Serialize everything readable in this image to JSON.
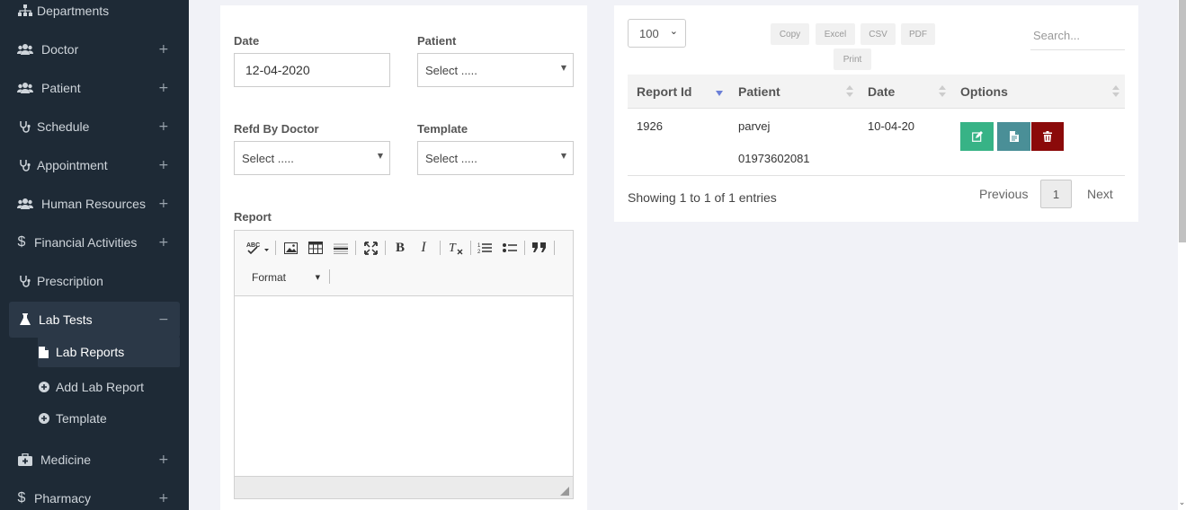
{
  "sidebar": {
    "items": [
      {
        "label": "Departments",
        "icon": "sitemap-icon",
        "expand": ""
      },
      {
        "label": "Doctor",
        "icon": "users-icon",
        "expand": "+"
      },
      {
        "label": "Patient",
        "icon": "users-icon",
        "expand": "+"
      },
      {
        "label": "Schedule",
        "icon": "stethoscope-icon",
        "expand": "+"
      },
      {
        "label": "Appointment",
        "icon": "stethoscope-icon",
        "expand": "+"
      },
      {
        "label": "Human Resources",
        "icon": "users-icon",
        "expand": "+"
      },
      {
        "label": "Financial Activities",
        "icon": "dollar-icon",
        "expand": "+"
      },
      {
        "label": "Prescription",
        "icon": "stethoscope-icon",
        "expand": ""
      },
      {
        "label": "Lab Tests",
        "icon": "flask-icon",
        "expand": "−"
      },
      {
        "label": "Medicine",
        "icon": "medkit-icon",
        "expand": "+"
      },
      {
        "label": "Pharmacy",
        "icon": "dollar-icon",
        "expand": "+"
      }
    ],
    "lab_sub": [
      {
        "label": "Lab Reports",
        "icon": "file-icon"
      },
      {
        "label": "Add Lab Report",
        "icon": "plus-circle-icon"
      },
      {
        "label": "Template",
        "icon": "plus-circle-icon"
      }
    ]
  },
  "form": {
    "date_label": "Date",
    "date_value": "12-04-2020",
    "patient_label": "Patient",
    "patient_value": "Select .....",
    "doctor_label": "Refd By Doctor",
    "doctor_value": "Select .....",
    "template_label": "Template",
    "template_value": "Select .....",
    "report_label": "Report",
    "format_label": "Format"
  },
  "table": {
    "page_length": "100",
    "buttons": [
      "Copy",
      "Excel",
      "CSV",
      "PDF",
      "Print"
    ],
    "search_placeholder": "Search...",
    "headers": [
      "Report Id",
      "Patient",
      "Date",
      "Options"
    ],
    "rows": [
      {
        "id": "1926",
        "patient_name": "parvej",
        "patient_phone": "01973602081",
        "date": "10-04-20"
      }
    ],
    "info": "Showing 1 to 1 of 1 entries",
    "prev": "Previous",
    "current_page": "1",
    "next": "Next"
  },
  "colors": {
    "sidebar_bg": "#1e2a36",
    "edit_btn": "#37b386",
    "view_btn": "#4a8f97",
    "delete_btn": "#8b0a0a"
  }
}
